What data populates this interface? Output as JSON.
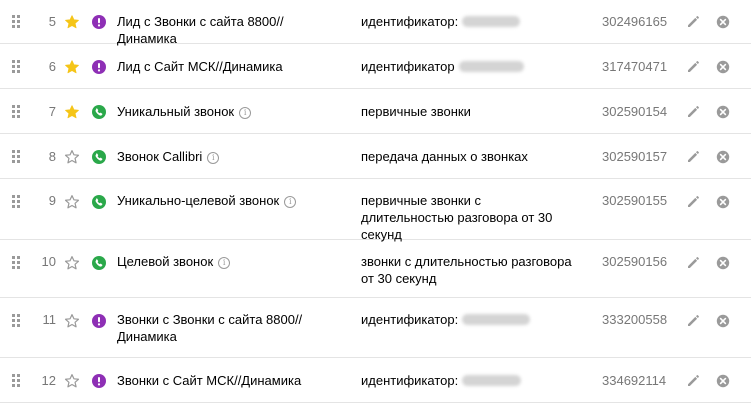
{
  "rows": [
    {
      "num": "5",
      "starred": true,
      "type": "identifier",
      "name": "Лид с Звонки с сайта 8800//Динамика",
      "info": false,
      "condition": "идентификатор:",
      "redacted": true,
      "id": "302496165"
    },
    {
      "num": "6",
      "starred": true,
      "type": "identifier",
      "name": "Лид с Сайт МСК//Динамика",
      "info": false,
      "condition": "идентификатор",
      "redacted": true,
      "id": "317470471"
    },
    {
      "num": "7",
      "starred": true,
      "type": "call",
      "name": "Уникальный звонок",
      "info": true,
      "condition": "первичные звонки",
      "redacted": false,
      "id": "302590154"
    },
    {
      "num": "8",
      "starred": false,
      "type": "call",
      "name": "Звонок Callibri",
      "info": true,
      "condition": "передача данных о звонках",
      "redacted": false,
      "id": "302590157"
    },
    {
      "num": "9",
      "starred": false,
      "type": "call",
      "name": "Уникально-целевой звонок",
      "info": true,
      "condition": "первичные звонки с длительностью разговора от 30 секунд",
      "redacted": false,
      "id": "302590155"
    },
    {
      "num": "10",
      "starred": false,
      "type": "call",
      "name": "Целевой звонок",
      "info": true,
      "condition": "звонки с длительностью разговора от 30 секунд",
      "redacted": false,
      "id": "302590156"
    },
    {
      "num": "11",
      "starred": false,
      "type": "identifier",
      "name": "Звонки с Звонки с сайта 8800// Динамика",
      "info": false,
      "condition": "идентификатор:",
      "redacted": true,
      "id": "333200558"
    },
    {
      "num": "12",
      "starred": false,
      "type": "identifier",
      "name": "Звонки с Сайт МСК//Динамика",
      "info": false,
      "condition": "идентификатор:",
      "redacted": true,
      "id": "334692114"
    }
  ],
  "colors": {
    "star_active": "#f5c518",
    "star_inactive": "#9a9a9a",
    "identifier_icon": "#8e2fb5",
    "call_icon": "#2aa84a",
    "action_icon": "#9a9a9a"
  },
  "icons": {
    "drag": "drag-handle-icon",
    "star": "star-icon",
    "identifier": "exclamation-circle-icon",
    "call": "phone-circle-icon",
    "info": "info-icon",
    "edit": "pencil-icon",
    "delete": "close-circle-icon"
  }
}
